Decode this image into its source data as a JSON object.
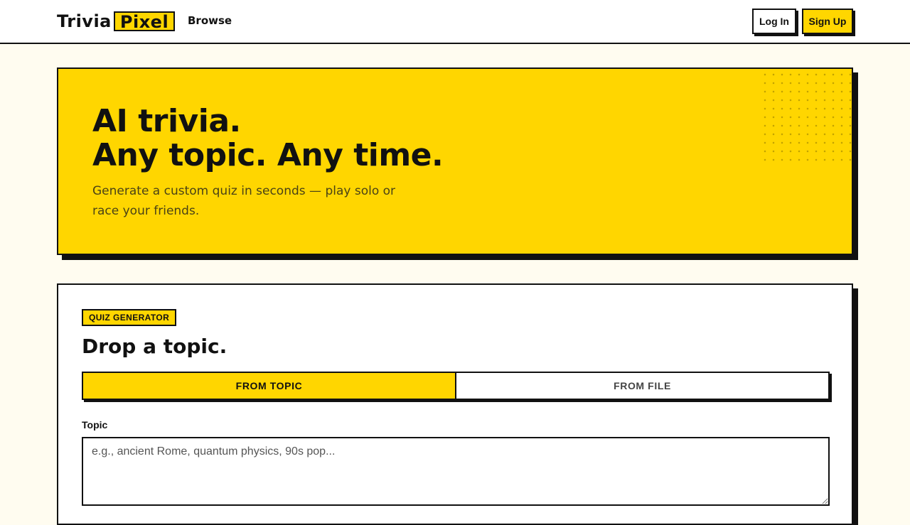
{
  "header": {
    "logo_word1": "Trivia",
    "logo_word2": "Pixel",
    "browse_label": "Browse",
    "login_label": "Log In",
    "signup_label": "Sign Up"
  },
  "hero": {
    "title_line1": "AI trivia.",
    "title_line2": "Any topic. Any time.",
    "subtitle": "Generate a custom quiz in seconds — play solo or race your friends."
  },
  "generator": {
    "badge": "QUIZ GENERATOR",
    "heading": "Drop a topic.",
    "tabs": [
      {
        "label": "FROM TOPIC",
        "active": true
      },
      {
        "label": "FROM FILE",
        "active": false
      }
    ],
    "topic_label": "Topic",
    "topic_placeholder": "e.g., ancient Rome, quantum physics, 90s pop...",
    "topic_value": ""
  },
  "colors": {
    "accent": "#ffd600",
    "ink": "#111111",
    "page_bg": "#fffcf0"
  }
}
